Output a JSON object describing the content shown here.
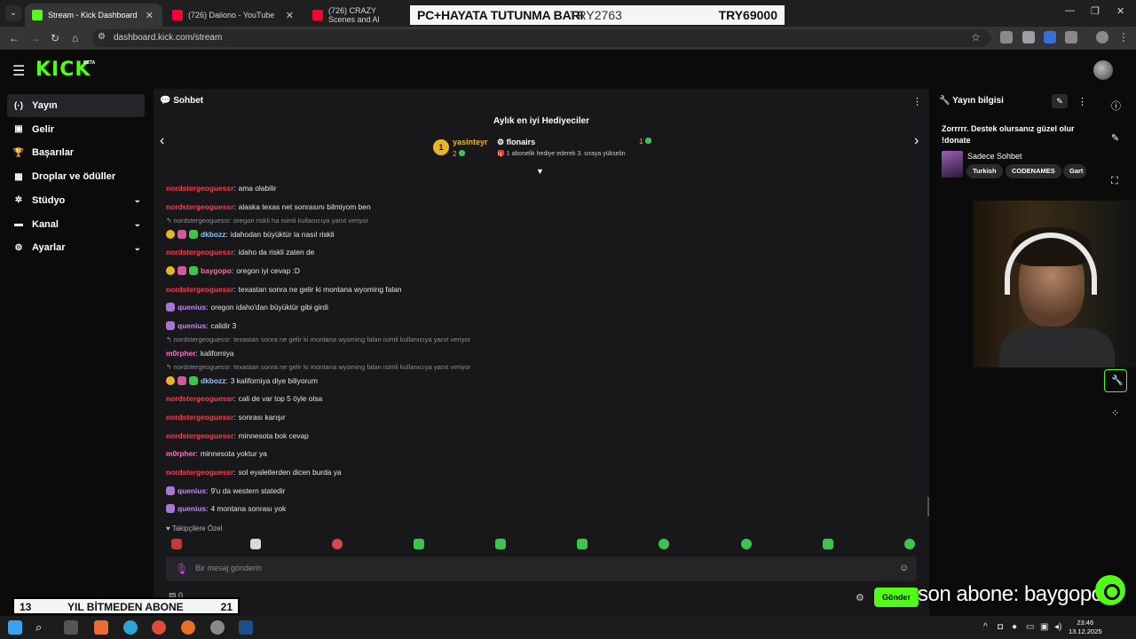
{
  "browser": {
    "tabs": [
      {
        "label": "Stream - Kick Dashboard",
        "active": true,
        "color": "#53fc18"
      },
      {
        "label": "(726) Daiiono - YouTube",
        "active": false,
        "color": "#ff0033"
      },
      {
        "label": "(726) CRAZY Scenes and Al",
        "active": false,
        "color": "#ff0033"
      }
    ],
    "url": "dashboard.kick.com/stream"
  },
  "top_overlay": {
    "text": "PC+HAYATA TUTUNMA BARI",
    "current": "TRY2763",
    "goal": "TRY69000"
  },
  "brand": {
    "logo": "KICK",
    "beta": "BETA",
    "accent": "#53fc18"
  },
  "sidebar": {
    "items": [
      {
        "label": "Yayın",
        "icon": "broadcast-icon",
        "glyph": "(·)",
        "active": true,
        "chevron": false
      },
      {
        "label": "Gelir",
        "icon": "revenue-icon",
        "glyph": "▣",
        "active": false,
        "chevron": false
      },
      {
        "label": "Başarılar",
        "icon": "trophy-icon",
        "glyph": "🏆",
        "active": false,
        "chevron": false
      },
      {
        "label": "Droplar ve ödüller",
        "icon": "drops-icon",
        "glyph": "▦",
        "active": false,
        "chevron": false
      },
      {
        "label": "Stüdyo",
        "icon": "studio-icon",
        "glyph": "✲",
        "active": false,
        "chevron": true
      },
      {
        "label": "Kanal",
        "icon": "channel-icon",
        "glyph": "▬",
        "active": false,
        "chevron": true
      },
      {
        "label": "Ayarlar",
        "icon": "settings-icon",
        "glyph": "⚙",
        "active": false,
        "chevron": true
      }
    ]
  },
  "chat": {
    "title": "Sohbet",
    "gifters_title": "Aylık en iyi Hediyeciler",
    "gifter1": {
      "rank": "1",
      "name": "yasinteyr",
      "count": "2"
    },
    "gifter2": {
      "name": "flonairs",
      "count": "1",
      "info": "1 abonelik hediye ederek 3. sıraya yükselin"
    },
    "messages": [
      {
        "type": "msg",
        "badges": [],
        "user": "nordstergeoguessr",
        "ucls": "u-red",
        "text": "ama olabilir"
      },
      {
        "type": "msg",
        "badges": [],
        "user": "nordstergeoguessr",
        "ucls": "u-red",
        "text": "alaska texas net sonrasını bilmiyom ben"
      },
      {
        "type": "reply",
        "text": "↰ nordstergeoguessr: oregon riskli ha isimli kullanıcıya yanıt veriyor"
      },
      {
        "type": "msg",
        "badges": [
          "b-gold",
          "b-pink",
          "b-green"
        ],
        "user": "dkbozz",
        "ucls": "u-blue",
        "text": "idahodan büyüktür la nasıl riskli"
      },
      {
        "type": "msg",
        "badges": [],
        "user": "nordstergeoguessr",
        "ucls": "u-red",
        "text": "idaho da riskli zaten de"
      },
      {
        "type": "msg",
        "badges": [
          "b-gold",
          "b-pink",
          "b-green"
        ],
        "user": "baygopo",
        "ucls": "u-pink",
        "text": "oregon iyi cevap :D"
      },
      {
        "type": "msg",
        "badges": [],
        "user": "nordstergeoguessr",
        "ucls": "u-red",
        "text": "texastan sonra ne gelir ki montana wyoming falan"
      },
      {
        "type": "msg",
        "badges": [
          "b-purple"
        ],
        "user": "quenius",
        "ucls": "u-purple",
        "text": "oregon idaho'dan büyüktür gibi girdi"
      },
      {
        "type": "msg",
        "badges": [
          "b-purple"
        ],
        "user": "quenius",
        "ucls": "u-purple",
        "text": "calidir 3"
      },
      {
        "type": "reply",
        "text": "↰ nordstergeoguessr: texastan sonra ne gelir ki montana wyoming falan isimli kullanıcıya yanıt veriyor"
      },
      {
        "type": "msg",
        "badges": [],
        "user": "m0rpher",
        "ucls": "u-mag",
        "text": "kaliforniya"
      },
      {
        "type": "reply",
        "text": "↰ nordstergeoguessr: texastan sonra ne gelir ki montana wyoming falan isimli kullanıcıya yanıt veriyor"
      },
      {
        "type": "msg",
        "badges": [
          "b-gold",
          "b-pink",
          "b-green"
        ],
        "user": "dkbozz",
        "ucls": "u-blue",
        "text": "3 kaliforniya diye biliyorum"
      },
      {
        "type": "msg",
        "badges": [],
        "user": "nordstergeoguessr",
        "ucls": "u-red",
        "text": "cali de var top 5 öyle olsa"
      },
      {
        "type": "msg",
        "badges": [],
        "user": "nordstergeoguessr",
        "ucls": "u-red",
        "text": "sonrası karışır"
      },
      {
        "type": "msg",
        "badges": [],
        "user": "nordstergeoguessr",
        "ucls": "u-red",
        "text": "minnesota bok cevap"
      },
      {
        "type": "msg",
        "badges": [],
        "user": "m0rpher",
        "ucls": "u-mag",
        "text": "minnesota yoktur ya"
      },
      {
        "type": "msg",
        "badges": [],
        "user": "nordstergeoguessr",
        "ucls": "u-red",
        "text": "sol eyaletlerden dicen burda ya"
      },
      {
        "type": "msg",
        "badges": [
          "b-purple"
        ],
        "user": "quenius",
        "ucls": "u-purple",
        "text": "9'u da western statedir"
      },
      {
        "type": "msg",
        "badges": [
          "b-purple"
        ],
        "user": "quenius",
        "ucls": "u-purple",
        "text": "4 montana sonrası yok"
      }
    ],
    "followers_only": "♥ Takipçilere Özel",
    "input_placeholder": "Bir mesaj gönderin",
    "send_label": "Gönder",
    "count": "0"
  },
  "stream_info": {
    "title": "Yayın bilgisi",
    "stream_title": "Zorrrrr. Destek olursanız güzel olur !donate",
    "category": "Sadece Sohbet",
    "tags": [
      "Turkish",
      "CODENAMES",
      "Gart"
    ]
  },
  "bottom_overlay": {
    "left_num": "13",
    "text": "YIL BİTMEDEN ABONE",
    "right_num": "21"
  },
  "last_sub": "son abone: baygopo",
  "clock": {
    "time": "23:46",
    "date": "13.12.2025"
  }
}
